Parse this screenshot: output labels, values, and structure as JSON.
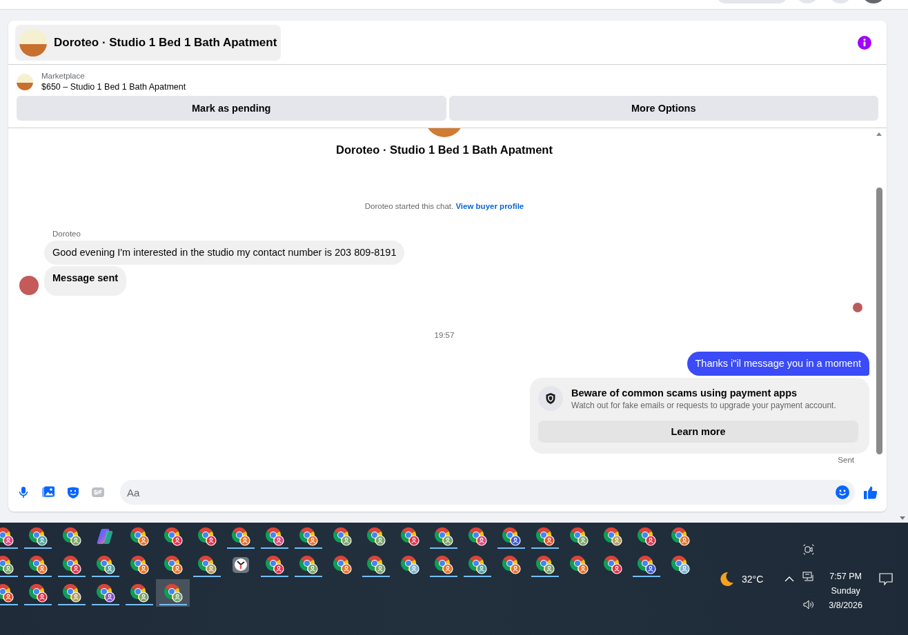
{
  "chat": {
    "title": "Doroteo · Studio 1 Bed 1 Bath Apatment"
  },
  "listing": {
    "label": "Marketplace",
    "title": "$650 – Studio 1 Bed 1 Bath Apatment",
    "actions": [
      "Mark as pending",
      "More Options"
    ]
  },
  "conversation": {
    "title": "Doroteo · Studio 1 Bed 1 Bath Apatment",
    "intro": "Doroteo started this chat.",
    "intro_link": "View buyer profile"
  },
  "messages": [
    {
      "kind": "sender",
      "text": "Doroteo"
    },
    {
      "kind": "incoming",
      "text": "Good evening I'm interested in the studio my contact number is 203 809-8191",
      "bold": false
    },
    {
      "kind": "incoming",
      "text": "Message sent",
      "bold": true
    },
    {
      "kind": "receipt"
    },
    {
      "kind": "time",
      "text": "19:57"
    },
    {
      "kind": "outgoing",
      "text": "Thanks i\"il message you in a moment"
    },
    {
      "kind": "notice",
      "title": "Beware of common scams using payment apps",
      "body": "Watch out for fake emails or requests to upgrade your payment account.",
      "button": "Learn more"
    },
    {
      "kind": "status",
      "text": "Sent"
    }
  ],
  "composer": {
    "placeholder": "Aa"
  },
  "taskbar": {
    "rows": [
      [
        {
          "kind": "chrome",
          "color": "#e0457b",
          "running": true,
          "selected": false
        },
        {
          "kind": "chrome",
          "color": "#4fa3a5",
          "running": true,
          "selected": false
        },
        {
          "kind": "chrome",
          "color": "#7aa66a",
          "running": false,
          "selected": false
        },
        {
          "kind": "copilot",
          "running": false,
          "selected": false
        },
        {
          "kind": "chrome",
          "color": "#e8732c",
          "running": false,
          "selected": false
        },
        {
          "kind": "chrome",
          "color": "#e3304a",
          "running": false,
          "selected": false
        },
        {
          "kind": "chrome",
          "color": "#e3304a",
          "running": false,
          "selected": false
        },
        {
          "kind": "chrome",
          "color": "#e8732c",
          "running": true,
          "selected": false
        },
        {
          "kind": "chrome",
          "color": "#e0457b",
          "running": true,
          "selected": false
        },
        {
          "kind": "chrome",
          "color": "#e8732c",
          "running": true,
          "selected": false
        },
        {
          "kind": "chrome",
          "color": "#7aa66a",
          "running": false,
          "selected": false
        },
        {
          "kind": "chrome",
          "color": "#7aa66a",
          "running": false,
          "selected": false
        },
        {
          "kind": "chrome",
          "color": "#e3304a",
          "running": false,
          "selected": false
        },
        {
          "kind": "chrome",
          "color": "#7aa66a",
          "running": true,
          "selected": false
        },
        {
          "kind": "chrome",
          "color": "#e0457b",
          "running": false,
          "selected": false
        },
        {
          "kind": "chrome",
          "color": "#3b5bd6",
          "running": true,
          "selected": false
        },
        {
          "kind": "chrome",
          "color": "#e8502c",
          "running": true,
          "selected": false
        },
        {
          "kind": "chrome",
          "color": "#7aa66a",
          "running": false,
          "selected": false
        },
        {
          "kind": "chrome",
          "color": "#b3a05a",
          "running": false,
          "selected": false
        },
        {
          "kind": "chrome",
          "color": "#e3304a",
          "running": false,
          "selected": false
        },
        {
          "kind": "chrome",
          "color": "#e8732c",
          "running": false,
          "selected": false
        }
      ],
      [
        {
          "kind": "chrome",
          "color": "#7aa66a",
          "running": true,
          "selected": false
        },
        {
          "kind": "chrome",
          "color": "#e8732c",
          "running": true,
          "selected": false
        },
        {
          "kind": "chrome",
          "color": "#e3304a",
          "running": true,
          "selected": false
        },
        {
          "kind": "chrome",
          "color": "#4fa3a5",
          "running": true,
          "selected": false
        },
        {
          "kind": "chrome",
          "color": "#e8732c",
          "running": false,
          "selected": false
        },
        {
          "kind": "chrome",
          "color": "#e8732c",
          "running": false,
          "selected": false
        },
        {
          "kind": "chrome",
          "color": "#b3a05a",
          "running": true,
          "selected": false
        },
        {
          "kind": "clock",
          "running": false,
          "selected": false
        },
        {
          "kind": "chrome",
          "color": "#e3304a",
          "running": true,
          "selected": false
        },
        {
          "kind": "chrome",
          "color": "#7aa66a",
          "running": true,
          "selected": false
        },
        {
          "kind": "chrome",
          "color": "#e8732c",
          "running": false,
          "selected": false
        },
        {
          "kind": "chrome",
          "color": "#7aa66a",
          "running": true,
          "selected": false
        },
        {
          "kind": "chrome",
          "color": "#7bb3d6",
          "running": false,
          "selected": false
        },
        {
          "kind": "chrome",
          "color": "#e8732c",
          "running": true,
          "selected": false
        },
        {
          "kind": "chrome",
          "color": "#4fa3a5",
          "running": true,
          "selected": false
        },
        {
          "kind": "chrome",
          "color": "#e8732c",
          "running": false,
          "selected": false
        },
        {
          "kind": "chrome",
          "color": "#7aa66a",
          "running": true,
          "selected": false
        },
        {
          "kind": "chrome",
          "color": "#e8732c",
          "running": false,
          "selected": false
        },
        {
          "kind": "chrome",
          "color": "#e3304a",
          "running": false,
          "selected": false
        },
        {
          "kind": "chrome",
          "color": "#3b5bd6",
          "running": true,
          "selected": false
        },
        {
          "kind": "chrome",
          "color": "#7bb3d6",
          "running": false,
          "selected": false
        }
      ],
      [
        {
          "kind": "chrome",
          "color": "#e8502c",
          "running": true,
          "selected": false
        },
        {
          "kind": "chrome",
          "color": "#e3304a",
          "running": true,
          "selected": false
        },
        {
          "kind": "chrome",
          "color": "#b3a05a",
          "running": true,
          "selected": false
        },
        {
          "kind": "chrome",
          "color": "#8a4fd0",
          "running": true,
          "selected": false
        },
        {
          "kind": "chrome",
          "color": "#7aa66a",
          "running": true,
          "selected": false
        },
        {
          "kind": "chrome",
          "color": "#7aa66a",
          "running": true,
          "selected": true
        }
      ]
    ],
    "weather": "32°C",
    "time": "7:57 PM",
    "day": "Sunday",
    "date": "3/8/2026"
  }
}
